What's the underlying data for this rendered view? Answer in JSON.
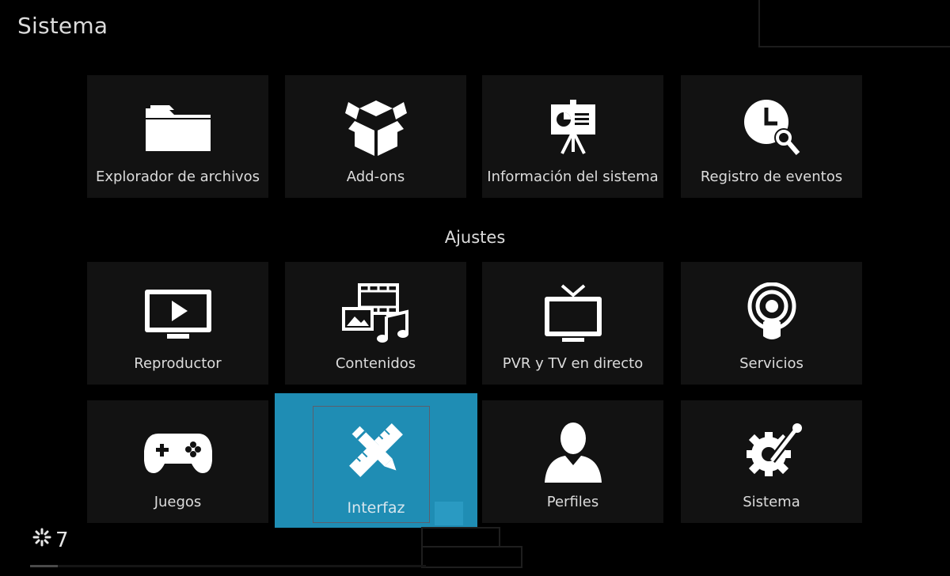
{
  "header": {
    "title": "Sistema"
  },
  "row1": [
    {
      "label": "Explorador de archivos",
      "icon": "folder-icon"
    },
    {
      "label": "Add-ons",
      "icon": "open-box-icon"
    },
    {
      "label": "Información del sistema",
      "icon": "presentation-chart-icon"
    },
    {
      "label": "Registro de eventos",
      "icon": "clock-search-icon"
    }
  ],
  "section": {
    "title": "Ajustes"
  },
  "row2": [
    {
      "label": "Reproductor",
      "icon": "tv-play-icon"
    },
    {
      "label": "Contenidos",
      "icon": "media-library-icon"
    },
    {
      "label": "PVR y TV en directo",
      "icon": "tv-antenna-icon"
    },
    {
      "label": "Servicios",
      "icon": "podcast-icon"
    }
  ],
  "row3": [
    {
      "label": "Juegos",
      "icon": "gamepad-icon"
    },
    {
      "label": "Interfaz",
      "icon": "pencil-ruler-icon",
      "focused": true
    },
    {
      "label": "Perfiles",
      "icon": "user-icon"
    },
    {
      "label": "Sistema",
      "icon": "gear-wrench-icon"
    }
  ],
  "status": {
    "value": "7",
    "icon": "loading-spinner-icon"
  },
  "progress": {
    "fraction": 0.07
  },
  "colors": {
    "focus": "#1f8db4",
    "tile": "#121212",
    "background": "#000000"
  }
}
